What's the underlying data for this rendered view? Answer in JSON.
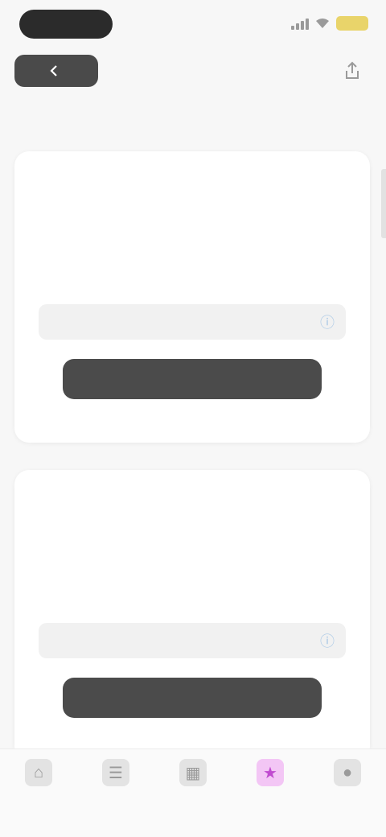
{
  "status_bar": {
    "time": "",
    "battery": ""
  },
  "header": {
    "back_label": "",
    "page_title": ""
  },
  "cards": [
    {
      "line1": "",
      "line2": "",
      "line3": "",
      "input_value": "",
      "input_placeholder": "",
      "button_label": ""
    },
    {
      "line1": "",
      "line2": "",
      "line3": "",
      "input_value": "",
      "input_placeholder": "",
      "button_label": ""
    }
  ],
  "tabs": [
    {
      "label": "",
      "icon": "home-icon"
    },
    {
      "label": "",
      "icon": "list-icon"
    },
    {
      "label": "",
      "icon": "grid-icon"
    },
    {
      "label": "",
      "icon": "star-icon",
      "active": true
    },
    {
      "label": "",
      "icon": "user-icon"
    }
  ],
  "colors": {
    "accent": "#c04bd0",
    "button": "#4b4b4b",
    "background": "#f7f7f7"
  }
}
